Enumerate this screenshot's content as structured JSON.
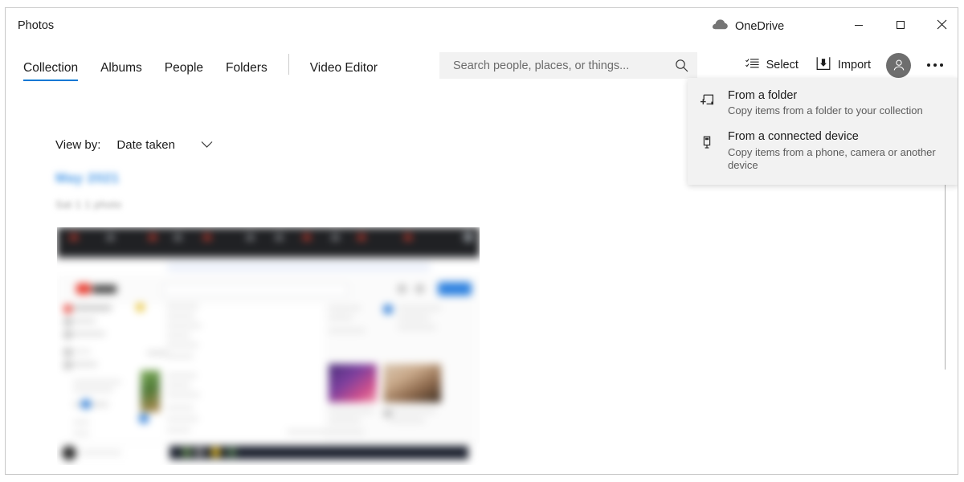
{
  "window": {
    "title": "Photos",
    "onedrive_label": "OneDrive",
    "onedrive_icon": "cloud-icon",
    "minimize_icon": "minimize-icon",
    "maximize_icon": "maximize-icon",
    "close_icon": "close-icon"
  },
  "tabs": [
    {
      "label": "Collection",
      "active": true
    },
    {
      "label": "Albums",
      "active": false
    },
    {
      "label": "People",
      "active": false
    },
    {
      "label": "Folders",
      "active": false
    },
    {
      "label": "Video Editor",
      "active": false
    }
  ],
  "search": {
    "placeholder": "Search people, places, or things...",
    "value": "",
    "icon": "search-icon"
  },
  "commands": {
    "select_label": "Select",
    "select_icon": "checklist-icon",
    "import_label": "Import",
    "import_icon": "import-tray-icon",
    "avatar_icon": "person-avatar-icon",
    "more_icon": "ellipsis-icon"
  },
  "import_menu": {
    "open": true,
    "items": [
      {
        "title": "From a folder",
        "subtitle": "Copy items from a folder to your collection",
        "icon": "folder-add-icon"
      },
      {
        "title": "From a connected device",
        "subtitle": "Copy items from a phone, camera or another device",
        "icon": "usb-device-icon"
      }
    ]
  },
  "content": {
    "view_by_label": "View by:",
    "view_by_value": "Date taken",
    "view_by_chevron": "chevron-down-icon",
    "group_date": "May 2021",
    "group_subtitle": "Sat 1  1 photo",
    "photo_alt": "blurred-browser-screenshot-thumbnail"
  },
  "scrollbar": {
    "handle_icon": "scroll-date-handle"
  },
  "colors": {
    "accent": "#0078d4",
    "menu_bg": "#f2f2f2",
    "search_bg": "#f2f2f2",
    "text": "#1b1b1b",
    "subtext": "#5c5c5c",
    "avatar_bg": "#6e6e6e"
  }
}
